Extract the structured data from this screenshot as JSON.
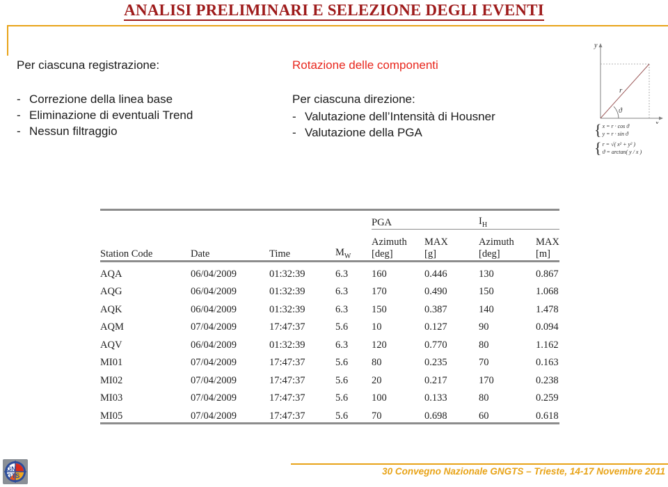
{
  "slide": {
    "title": "ANALISI PRELIMINARI E SELEZIONE DEGLI EVENTI",
    "accent_color": "#9E1B1B",
    "frame_color": "#E8A317",
    "highlight_color": "#E8261C"
  },
  "left_column": {
    "heading": "Per ciascuna registrazione:",
    "dash": "-",
    "bullets": [
      "Correzione della linea base",
      "Eliminazione di eventuali Trend",
      "Nessun filtraggio"
    ]
  },
  "middle_column": {
    "heading": "Rotazione delle componenti",
    "sub_heading": "Per ciascuna direzione:",
    "dash": "-",
    "bullets": [
      "Valutazione dell’Intensità di Housner",
      "Valutazione della PGA"
    ]
  },
  "diagram": {
    "axis_x_label": "x",
    "axis_y_label": "y",
    "vector_label": "r",
    "angle_label": "ϑ",
    "formulas_group1": [
      "x = r · cos ϑ",
      "y = r · sin ϑ"
    ],
    "formulas_group2": [
      "r = √( x² + y² )",
      "ϑ = arctan( y / x )"
    ]
  },
  "table": {
    "group_headers": [
      {
        "label": "PGA",
        "span": 2
      },
      {
        "label": "I",
        "sub": "H",
        "span": 2
      }
    ],
    "columns": [
      {
        "label": "Station Code",
        "unit": ""
      },
      {
        "label": "Date",
        "unit": ""
      },
      {
        "label": "Time",
        "unit": ""
      },
      {
        "label": "M",
        "sub": "W",
        "unit": ""
      },
      {
        "label": "Azimuth",
        "unit": "[deg]"
      },
      {
        "label": "MAX",
        "unit": "[g]"
      },
      {
        "label": "Azimuth",
        "unit": "[deg]"
      },
      {
        "label": "MAX",
        "unit": "[m]"
      }
    ],
    "rows": [
      [
        "AQA",
        "06/04/2009",
        "01:32:39",
        "6.3",
        "160",
        "0.446",
        "130",
        "0.867"
      ],
      [
        "AQG",
        "06/04/2009",
        "01:32:39",
        "6.3",
        "170",
        "0.490",
        "150",
        "1.068"
      ],
      [
        "AQK",
        "06/04/2009",
        "01:32:39",
        "6.3",
        "150",
        "0.387",
        "140",
        "1.478"
      ],
      [
        "AQM",
        "07/04/2009",
        "17:47:37",
        "5.6",
        "10",
        "0.127",
        "90",
        "0.094"
      ],
      [
        "AQV",
        "06/04/2009",
        "01:32:39",
        "6.3",
        "120",
        "0.770",
        "80",
        "1.162"
      ],
      [
        "MI01",
        "07/04/2009",
        "17:47:37",
        "5.6",
        "80",
        "0.235",
        "70",
        "0.163"
      ],
      [
        "MI02",
        "07/04/2009",
        "17:47:37",
        "5.6",
        "20",
        "0.217",
        "170",
        "0.238"
      ],
      [
        "MI03",
        "07/04/2009",
        "17:47:37",
        "5.6",
        "100",
        "0.133",
        "80",
        "0.259"
      ],
      [
        "MI05",
        "07/04/2009",
        "17:47:37",
        "5.6",
        "70",
        "0.698",
        "60",
        "0.618"
      ]
    ]
  },
  "footer": {
    "text": "30  Convegno Nazionale GNGTS – Trieste, 14-17 Novembre 2011",
    "logo_top_text": "GN",
    "logo_bottom_text": "GTS"
  }
}
